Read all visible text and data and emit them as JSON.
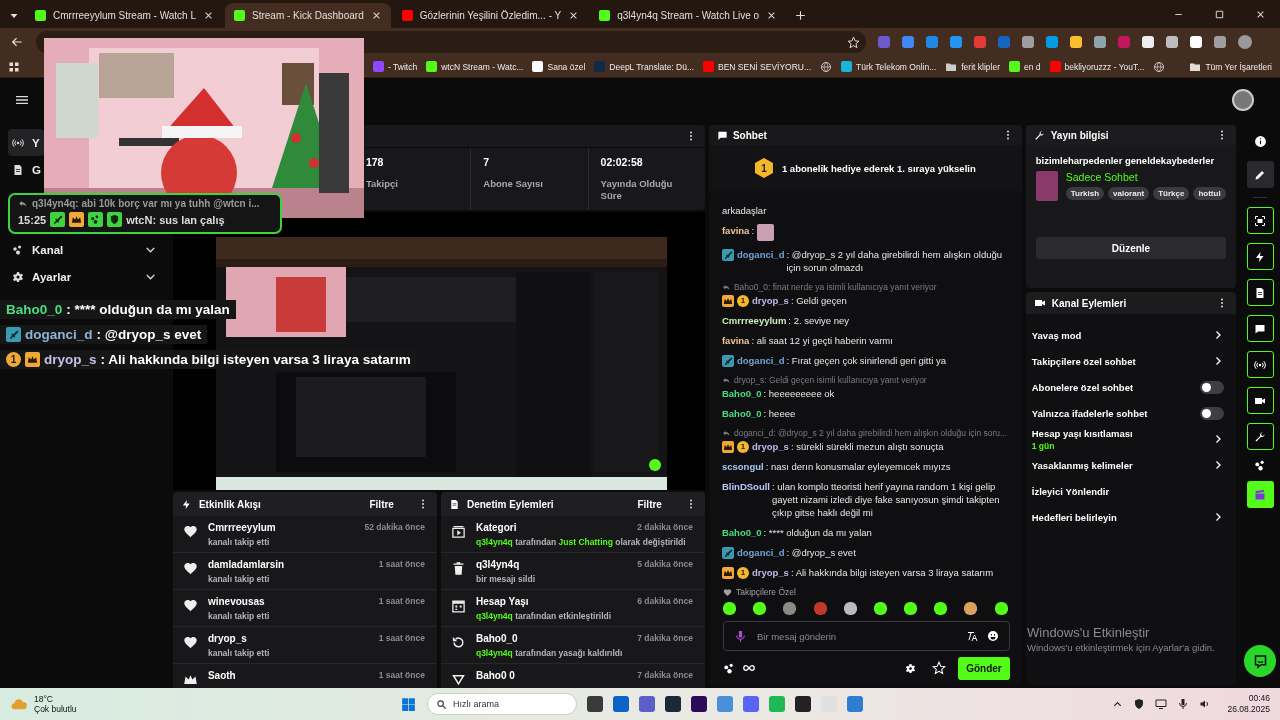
{
  "browser": {
    "tabs": [
      {
        "title": "Cmrrreeyylum Stream - Watch L",
        "color": "#53fc18",
        "selected": false
      },
      {
        "title": "Stream - Kick Dashboard",
        "color": "#53fc18",
        "selected": true
      },
      {
        "title": "Gözlerinin Yeşilini Özledim... - Y",
        "color": "#ff0000",
        "selected": false
      },
      {
        "title": "q3l4yn4q Stream - Watch Live o",
        "color": "#53fc18",
        "selected": false
      }
    ],
    "bookmarks": [
      {
        "label": "- Twitch",
        "kind": "site",
        "color": "#9146ff"
      },
      {
        "label": "wtcN Stream - Watc...",
        "kind": "site",
        "color": "#53fc18"
      },
      {
        "label": "Sana özel",
        "kind": "site",
        "color": "#ffffff"
      },
      {
        "label": "DeepL Translate: Dü...",
        "kind": "site",
        "color": "#0f2b46"
      },
      {
        "label": "BEN SENİ SEVİYORU...",
        "kind": "site",
        "color": "#ff0000"
      },
      {
        "kind": "globe"
      },
      {
        "label": "Türk Telekom Onlin...",
        "kind": "site",
        "color": "#19b5d8"
      },
      {
        "label": "ferit klipler",
        "kind": "folder",
        "color": "#cccccc"
      },
      {
        "label": "en d",
        "kind": "site",
        "color": "#53fc18"
      },
      {
        "label": "bekliyoruzzz - YouT...",
        "kind": "site",
        "color": "#ff0000"
      },
      {
        "kind": "globe"
      }
    ],
    "all_bookmarks": "Tüm Yer İşaretleri"
  },
  "sidebar": {
    "items": [
      {
        "label": "Y",
        "kind": "live",
        "selected": true
      },
      {
        "label": "G",
        "kind": "chart",
        "selected": false
      },
      {
        "label": "Kanal",
        "kind": "group",
        "selected": false
      },
      {
        "label": "Ayarlar",
        "kind": "settings",
        "selected": false
      }
    ]
  },
  "stats": [
    {
      "value": "178",
      "label": "Takipçi"
    },
    {
      "value": "7",
      "label": "Abone Sayısı"
    },
    {
      "value": "02:02:58",
      "label": "Yayında Olduğu Süre"
    }
  ],
  "stream_overlay": {
    "reply": "q3l4yn4q: abi 10k borç var mı ya tuhh @wtcn i...",
    "time": "15:25",
    "user": "wtcN",
    "message": ": sus lan çalış",
    "chat": [
      {
        "user": "Baho0_0",
        "color": "#4ade80",
        "text": " : **** olduğun da mı yalan"
      },
      {
        "user": "doganci_d",
        "color": "#8fb3d6",
        "badges": [
          {
            "kind": "moderator"
          }
        ],
        "text": " : @dryop_s evet"
      },
      {
        "user": "dryop_s",
        "color": "#c9bfe6",
        "badges": [
          {
            "kind": "rank",
            "label": "1"
          },
          {
            "kind": "crown"
          }
        ],
        "text": " : Ali hakkında bilgi isteyen varsa 3 liraya satarım"
      }
    ]
  },
  "activity": {
    "title": "Etkinlik Akışı",
    "filter": "Filtre",
    "items": [
      {
        "kind": "follow",
        "name": "Cmrrreeyylum",
        "detail": "kanalı takip etti",
        "time": "52 dakika önce"
      },
      {
        "kind": "follow",
        "name": "damladamlarsin",
        "detail": "kanalı takip etti",
        "time": "1 saat önce"
      },
      {
        "kind": "follow",
        "name": "winevousas",
        "detail": "kanalı takip etti",
        "time": "1 saat önce"
      },
      {
        "kind": "follow",
        "name": "dryop_s",
        "detail": "kanalı takip etti",
        "time": "1 saat önce"
      },
      {
        "kind": "subscribe",
        "name": "Saoth",
        "time": "1 saat önce"
      }
    ]
  },
  "moderation": {
    "title": "Denetim Eylemleri",
    "filter": "Filtre",
    "items": [
      {
        "kind": "category",
        "name": "Kategori",
        "time": "2 dakika önce",
        "detail": [
          {
            "text": "q3l4yn4q",
            "highlight": true
          },
          {
            "text": " tarafından ",
            "highlight": false
          },
          {
            "text": "Just Chatting",
            "highlight": true
          },
          {
            "text": " olarak değiştirildi",
            "highlight": false
          }
        ]
      },
      {
        "kind": "delete",
        "name": "q3l4yn4q",
        "time": "5 dakika önce",
        "detail": [
          {
            "text": "bir mesajı sildi",
            "highlight": false
          }
        ]
      },
      {
        "kind": "calendar",
        "name": "Hesap Yaşı",
        "time": "6 dakika önce",
        "detail": [
          {
            "text": "q3l4yn4q",
            "highlight": true
          },
          {
            "text": " tarafından etkinleştirildi",
            "highlight": false
          }
        ]
      },
      {
        "kind": "unban",
        "name": "Baho0_0",
        "time": "7 dakika önce",
        "detail": [
          {
            "text": "q3l4yn4q",
            "highlight": true
          },
          {
            "text": " tarafından yasağı kaldırıldı",
            "highlight": false
          }
        ]
      },
      {
        "kind": "down",
        "name": "Baho0 0",
        "time": "7 dakika önce"
      }
    ]
  },
  "chat": {
    "title": "Sohbet",
    "pinned_rank": "1",
    "pinned": "1 abonelik hediye ederek 1. sıraya yükselin",
    "messages": [
      {
        "kind": "continuation",
        "text": "arkadaşlar"
      },
      {
        "kind": "emote",
        "user": "favina",
        "color": "#f2c894",
        "text": ":"
      },
      {
        "kind": "text",
        "user": "doganci_d",
        "color": "#6fa3d8",
        "badges": [
          {
            "kind": "moderator"
          }
        ],
        "text": ": @dryop_s 2 yıl daha girebilirdi hem alışkın olduğu için sorun olmazdı"
      },
      {
        "kind": "text",
        "reply": "Baho0_0: finat nerde ya isimli kullanıcıya yanıt veriyor",
        "user": "dryop_s",
        "color": "#c3b5ea",
        "badges": [
          {
            "kind": "crown"
          },
          {
            "kind": "rank",
            "label": "1"
          }
        ],
        "text": ": Geldi geçen"
      },
      {
        "kind": "text",
        "user": "Cmrrreeyylum",
        "color": "#c8f0b8",
        "text": ": 2. seviye ney"
      },
      {
        "kind": "text",
        "user": "favina",
        "color": "#f2c894",
        "text": ": ali saat 12 yi geçti haberin varmı"
      },
      {
        "kind": "text",
        "user": "doganci_d",
        "color": "#6fa3d8",
        "badges": [
          {
            "kind": "moderator"
          }
        ],
        "text": ": Fırat geçen çok sinirlendi geri gitti ya"
      },
      {
        "kind": "text",
        "reply": "dryop_s: Geldi geçen isimli kullanıcıya yanıt veriyor",
        "user": "Baho0_0",
        "color": "#4ade80",
        "text": ": heeeeeeeee ok"
      },
      {
        "kind": "text",
        "user": "Baho0_0",
        "color": "#4ade80",
        "text": ": heeee"
      },
      {
        "kind": "text",
        "reply": "doganci_d: @dryop_s 2 yıl daha girebilirdi hem alışkın olduğu için soru...",
        "user": "dryop_s",
        "color": "#c3b5ea",
        "badges": [
          {
            "kind": "crown"
          },
          {
            "kind": "rank",
            "label": "1"
          }
        ],
        "text": ": sürekli sürekli mezun alıştı sonuçta"
      },
      {
        "kind": "text",
        "user": "scsongul",
        "color": "#a9c9f7",
        "text": ": nası derın konusmalar eyleyemıcek mıyızs"
      },
      {
        "kind": "text",
        "user": "BlinDSoull",
        "color": "#b8c8ff",
        "text": ": ulan komplo tteoristi herif yayına random 1 kişi gelip gayett nizami izledi diye fake sanıyosun şimdi takipten çıkıp gitse haklı değil mi"
      },
      {
        "kind": "text",
        "user": "Baho0_0",
        "color": "#4ade80",
        "text": ": **** olduğun da mı yalan"
      },
      {
        "kind": "text",
        "user": "doganci_d",
        "color": "#6fa3d8",
        "badges": [
          {
            "kind": "moderator"
          }
        ],
        "text": ": @dryop_s evet"
      },
      {
        "kind": "text",
        "user": "dryop_s",
        "color": "#c3b5ea",
        "badges": [
          {
            "kind": "crown"
          },
          {
            "kind": "rank",
            "label": "1"
          }
        ],
        "text": ": Ali hakkında bilgi isteyen varsa 3 liraya satarım"
      }
    ],
    "followers_label": "Takipçilere Özel",
    "placeholder": "Bir mesaj gönderin",
    "send": "Gönder"
  },
  "stream_info": {
    "title": "Yayın bilgisi",
    "stream_title": "bizimleharpedenler geneldekaybederler",
    "category": "Sadece Sohbet",
    "tags": [
      "Turkish",
      "valorant",
      "Türkçe",
      "hottul"
    ],
    "edit": "Düzenle"
  },
  "channel_actions": {
    "title": "Kanal Eylemleri",
    "items": [
      {
        "label": "Yavaş mod",
        "kind": "link"
      },
      {
        "label": "Takipçilere özel sohbet",
        "kind": "link"
      },
      {
        "label": "Abonelere özel sohbet",
        "kind": "toggle",
        "on": false
      },
      {
        "label": "Yalnızca ifadelerle sohbet",
        "kind": "toggle",
        "on": false
      },
      {
        "label": "Hesap yaşı kısıtlaması",
        "kind": "link",
        "value": "1 gün"
      },
      {
        "label": "Yasaklanmış kelimeler",
        "kind": "link"
      },
      {
        "label": "İzleyici Yönlendir",
        "kind": "plain"
      },
      {
        "label": "Hedefleri belirleyin",
        "kind": "link"
      }
    ]
  },
  "activation_notice": {
    "title": "Windows'u Etkinleştir",
    "text": "Windows'u etkinleştirmek için Ayarlar'a gidin."
  },
  "taskbar": {
    "temperature": "18°C",
    "weather": "Çok bulutlu",
    "search": "Hızlı arama",
    "time": "00:46",
    "date": "26.08.2025"
  }
}
